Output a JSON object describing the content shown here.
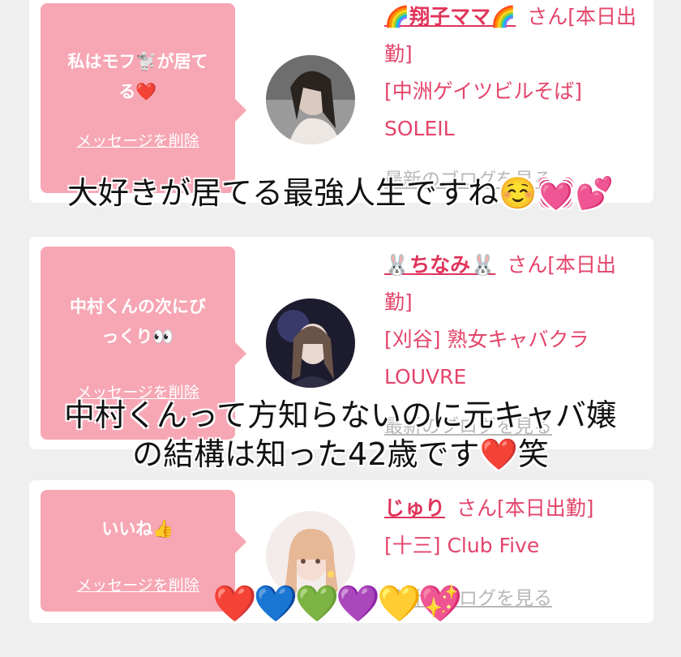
{
  "posts": [
    {
      "message_lines": [
        "私はモフ🐩が居て",
        "る❤️"
      ],
      "delete_label": "メッセージを削除",
      "name": "🌈翔子ママ🌈",
      "status": "さん[本日出勤]",
      "shop": "[中洲ゲイツビルそば] SOLEIL",
      "blog_label": "最新のブログを見る"
    },
    {
      "message_lines": [
        "中村くんの次にび",
        "っくり👀"
      ],
      "delete_label": "メッセージを削除",
      "name": "🐰ちなみ🐰",
      "status": "さん[本日出勤]",
      "shop": "[刈谷] 熟女キャバクラ LOUVRE",
      "blog_label": "最新のブログを見る"
    },
    {
      "message_lines": [
        "いいね👍"
      ],
      "delete_label": "メッセージを削除",
      "name": "じゅり",
      "status": "さん[本日出勤]",
      "shop": "[十三] Club Five",
      "blog_label": "最新のブログを見る"
    }
  ],
  "captions": {
    "first": "大好きが居てる最強人生ですね☺️💓💕",
    "second_line1": "中村くんって方知らないのに元キャバ嬢",
    "second_line2": "の結構は知った42歳です❤️笑"
  },
  "hearts_row": "❤️💙💚💜💛💖",
  "colors": {
    "bubble": "#f7a6b4",
    "accent": "#e0345b",
    "link_gray": "#b8b8b8",
    "background": "#efefef"
  }
}
